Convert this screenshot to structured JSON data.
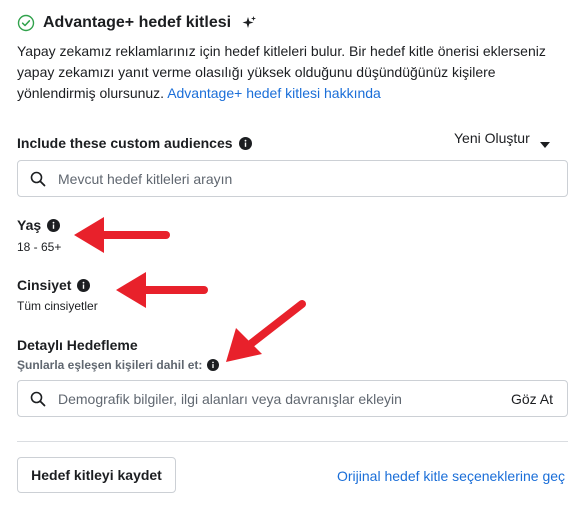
{
  "header": {
    "title": "Advantage+ hedef kitlesi",
    "check_icon": "check-circle-icon",
    "sparkle_icon": "sparkle-icon"
  },
  "description": {
    "text": "Yapay zekamız reklamlarınız için hedef kitleleri bulur. Bir hedef kitle önerisi eklerseniz yapay zekamızı yanıt verme olasılığı yüksek olduğunu düşündüğünüz kişilere yönlendirmiş olursunuz. ",
    "link": "Advantage+ hedef kitlesi hakkında"
  },
  "custom_audiences": {
    "label": "Include these custom audiences",
    "create_new": "Yeni Oluştur",
    "search_placeholder": "Mevcut hedef kitleleri arayın"
  },
  "age": {
    "label": "Yaş",
    "value": "18 - 65+"
  },
  "gender": {
    "label": "Cinsiyet",
    "value": "Tüm cinsiyetler"
  },
  "detailed_targeting": {
    "label": "Detaylı Hedefleme",
    "sub_label": "Şunlarla eşleşen kişileri dahil et:",
    "search_placeholder": "Demografik bilgiler, ilgi alanları veya davranışlar ekleyin",
    "browse": "Göz At"
  },
  "footer": {
    "save_button": "Hedef kitleyi kaydet",
    "original_link": "Orijinal hedef kitle seçeneklerine geç"
  },
  "colors": {
    "link": "#1a6ed8",
    "arrow": "#e8212b",
    "check": "#31a24c",
    "border": "#ccd0d5"
  }
}
